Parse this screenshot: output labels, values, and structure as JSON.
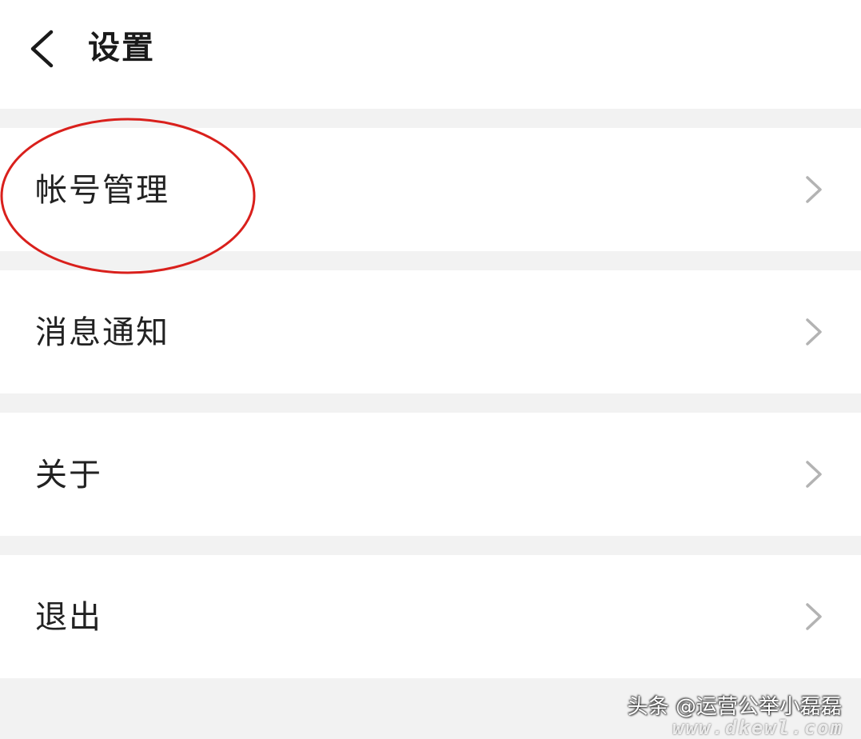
{
  "header": {
    "title": "设置",
    "back_icon": "chevron-left-icon"
  },
  "settings": {
    "items": [
      {
        "label": "帐号管理",
        "icon": "chevron-right-icon"
      },
      {
        "label": "消息通知",
        "icon": "chevron-right-icon"
      },
      {
        "label": "关于",
        "icon": "chevron-right-icon"
      },
      {
        "label": "退出",
        "icon": "chevron-right-icon"
      }
    ]
  },
  "annotation": {
    "shape": "ellipse",
    "color": "#d9201c",
    "target": "帐号管理"
  },
  "watermark": {
    "text": "头条 @运营公举小磊磊",
    "site": "www.dkewl.com"
  },
  "colors": {
    "background": "#f2f2f2",
    "surface": "#ffffff",
    "text": "#222222",
    "chevron": "#b3b3b3"
  }
}
